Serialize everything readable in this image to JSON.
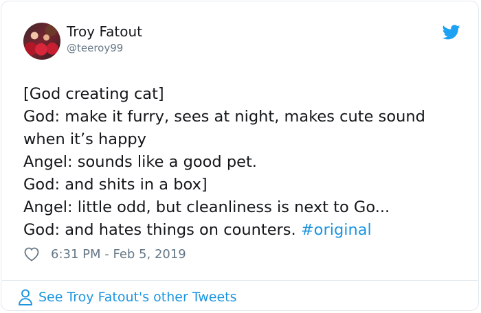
{
  "author": {
    "name": "Troy Fatout",
    "handle": "@teeroy99"
  },
  "tweet": {
    "lines": [
      "[God creating cat]",
      "God:  make it furry, sees at night, makes cute sound",
      "when it’s happy",
      "Angel:  sounds like a good pet.",
      "God:  and shits in a box]",
      "Angel:  little odd, but cleanliness is next to Go...",
      "God:  and hates things on counters."
    ],
    "hashtag": "#original"
  },
  "meta": {
    "timestamp": "6:31 PM - Feb 5, 2019"
  },
  "footer": {
    "link_label": "See Troy Fatout's other Tweets"
  },
  "icons": {
    "brand": "twitter-bird-icon",
    "like": "heart-icon",
    "profile": "person-icon"
  },
  "colors": {
    "accent": "#1b95e0",
    "text": "#14171a",
    "muted": "#657786",
    "border": "#e1e8ed"
  }
}
